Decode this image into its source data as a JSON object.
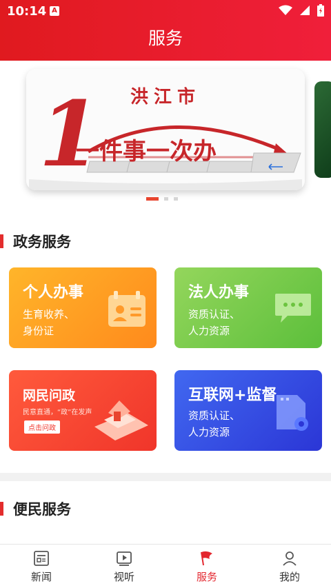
{
  "status_bar": {
    "time": "10:14",
    "notification_glyph": "A"
  },
  "header": {
    "title": "服务"
  },
  "banner": {
    "city": "洪江市",
    "slogan": "一件事一次办",
    "big_numeral": "1",
    "active_index": 0,
    "total_dots": 3
  },
  "sections": [
    {
      "title": "政务服务"
    },
    {
      "title": "便民服务"
    }
  ],
  "cards": [
    {
      "title": "个人办事",
      "subtitle": "生育收养、\n身份证",
      "icon": "id-card-icon",
      "color_from": "#ffb020",
      "color_to": "#ff8a1c"
    },
    {
      "title": "法人办事",
      "subtitle": "资质认证、\n人力资源",
      "icon": "chat-bubble-icon",
      "color_from": "#8fd35a",
      "color_to": "#5cbf3b"
    },
    {
      "title": "网民问政",
      "subtitle": "民意直通，“政”在发声",
      "button": "点击问政",
      "icon": "house-phone-icon",
      "color_from": "#ff5a3c",
      "color_to": "#f0352a"
    },
    {
      "title": "互联网+监督",
      "subtitle": "资质认证、\n人力资源",
      "icon": "document-gear-icon",
      "color_from": "#3f63f0",
      "color_to": "#2a39d8"
    }
  ],
  "tabbar": {
    "items": [
      {
        "label": "新闻",
        "icon": "news-icon"
      },
      {
        "label": "视听",
        "icon": "video-icon"
      },
      {
        "label": "服务",
        "icon": "flag-icon"
      },
      {
        "label": "我的",
        "icon": "person-icon"
      }
    ],
    "active_index": 2,
    "active_color": "#e3262e"
  },
  "colors": {
    "header_red": "#e01a1f",
    "accent_red": "#e32d2d"
  }
}
